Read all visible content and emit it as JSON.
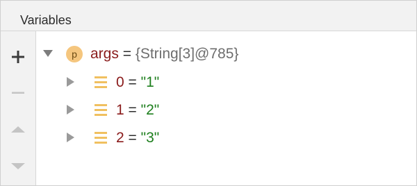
{
  "panel": {
    "title": "Variables"
  },
  "toolbar": {
    "items": [
      {
        "icon": "plus-icon",
        "label": "Add"
      },
      {
        "icon": "minus-icon",
        "label": "Remove"
      },
      {
        "icon": "arrow-up-icon",
        "label": "Move Up"
      },
      {
        "icon": "arrow-down-icon",
        "label": "Move Down"
      }
    ]
  },
  "tree": {
    "root": {
      "badge": "p",
      "name": "args",
      "equals": "=",
      "value": "{String[3]@785}",
      "expanded": true
    },
    "children": [
      {
        "name": "0",
        "equals": "=",
        "value": "\"1\""
      },
      {
        "name": "1",
        "equals": "=",
        "value": "\"2\""
      },
      {
        "name": "2",
        "equals": "=",
        "value": "\"3\""
      }
    ]
  },
  "colors": {
    "name": "#8a1b1b",
    "string_value": "#1e7f1e",
    "type_value": "#6d6d6d",
    "badge": "#f5c67e",
    "field_icon": "#f0c060"
  }
}
